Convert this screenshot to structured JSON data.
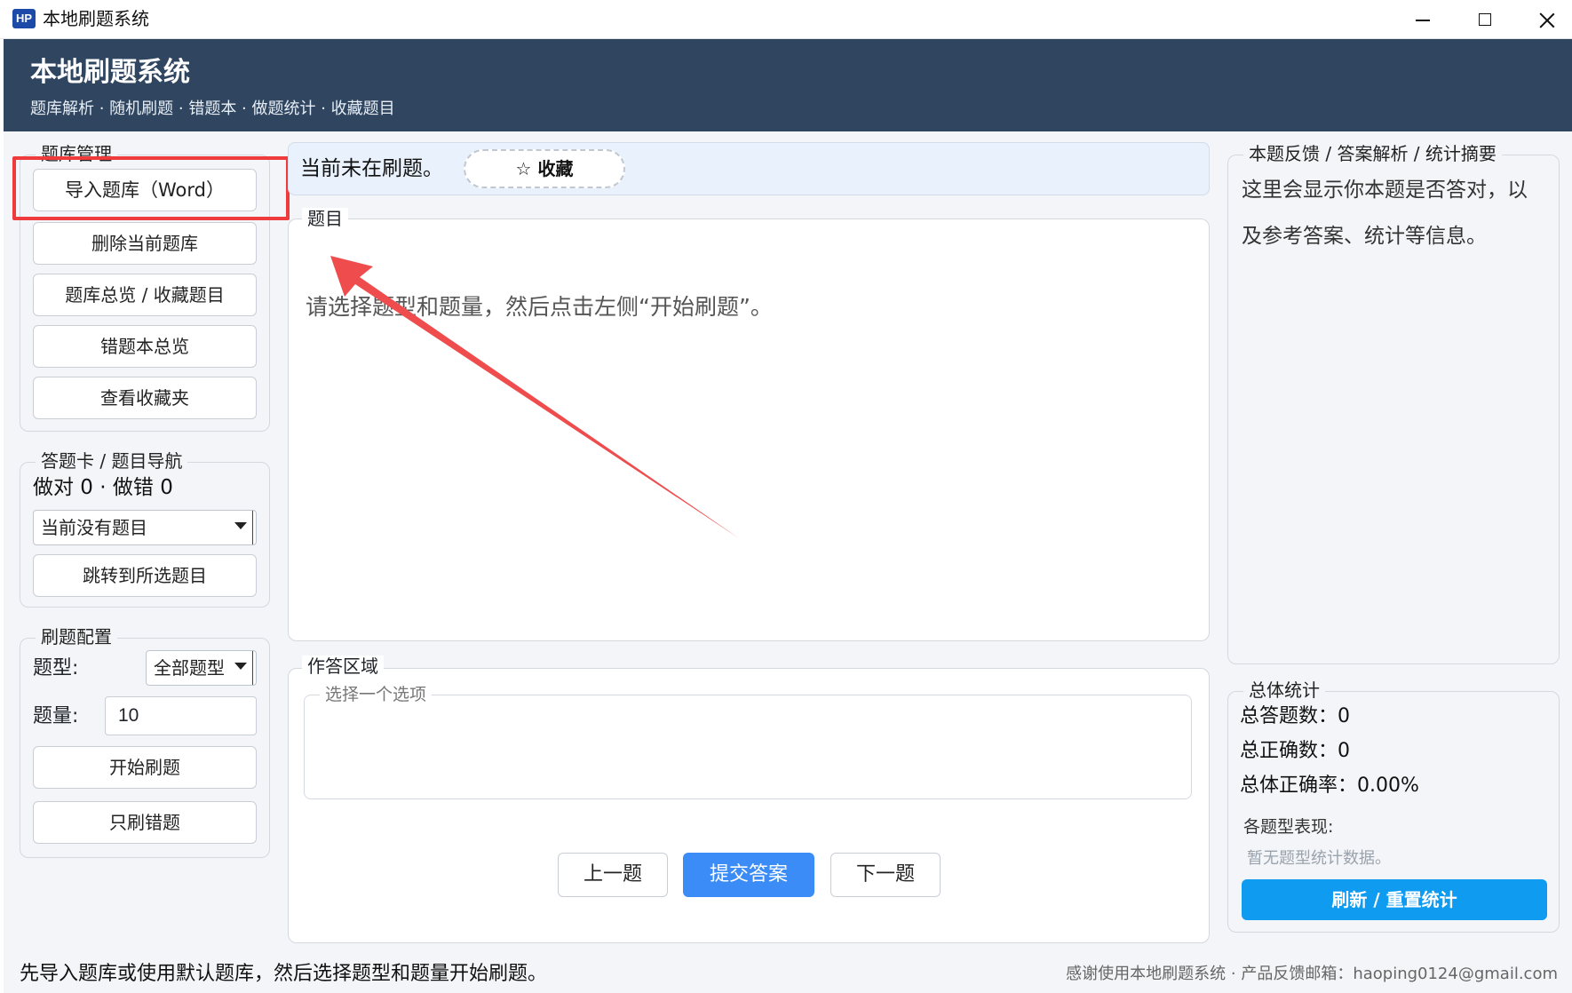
{
  "window": {
    "icon_text": "HP",
    "title": "本地刷题系统"
  },
  "header": {
    "title": "本地刷题系统",
    "subtitle": "题库解析 · 随机刷题 · 错题本 · 做题统计 · 收藏题目"
  },
  "bank": {
    "group_label": "题库管理",
    "import_label": "导入题库（Word）",
    "delete_label": "删除当前题库",
    "overview_label": "题库总览 / 收藏题目",
    "wrongbook_label": "错题本总览",
    "favorites_label": "查看收藏夹"
  },
  "answer_card": {
    "group_label": "答题卡 / 题目导航",
    "score_text": "做对 0 · 做错 0",
    "select_value": "当前没有题目",
    "jump_label": "跳转到所选题目"
  },
  "config": {
    "group_label": "刷题配置",
    "type_label": "题型:",
    "type_value": "全部题型",
    "count_label": "题量:",
    "count_value": "10",
    "start_label": "开始刷题",
    "wrong_only_label": "只刷错题"
  },
  "status_bar_top": {
    "text": "当前未在刷题。",
    "favorite_label": "☆ 收藏"
  },
  "question": {
    "group_label": "题目",
    "text": "请选择题型和题量，然后点击左侧“开始刷题”。"
  },
  "answer_area": {
    "group_label": "作答区域",
    "options_label": "选择一个选项",
    "prev_label": "上一题",
    "submit_label": "提交答案",
    "next_label": "下一题"
  },
  "feedback": {
    "group_label": "本题反馈 / 答案解析 / 统计摘要",
    "line1": "这里会显示你本题是否答对，以",
    "line2": "及参考答案、统计等信息。"
  },
  "overall": {
    "group_label": "总体统计",
    "total_answered": "总答题数：0",
    "total_correct": "总正确数：0",
    "accuracy": "总体正确率：0.00%",
    "per_type_label": "各题型表现:",
    "per_type_empty": "暂无题型统计数据。",
    "refresh_label": "刷新 / 重置统计"
  },
  "footer": {
    "left": "先导入题库或使用默认题库，然后选择题型和题量开始刷题。",
    "right": "感谢使用本地刷题系统 · 产品反馈邮箱：haoping0124@gmail.com"
  },
  "colors": {
    "header_bg": "#2f4560",
    "primary_blue": "#3b8cf6",
    "refresh_blue": "#0f9bf0",
    "annotation_red": "#ef3b3b"
  }
}
